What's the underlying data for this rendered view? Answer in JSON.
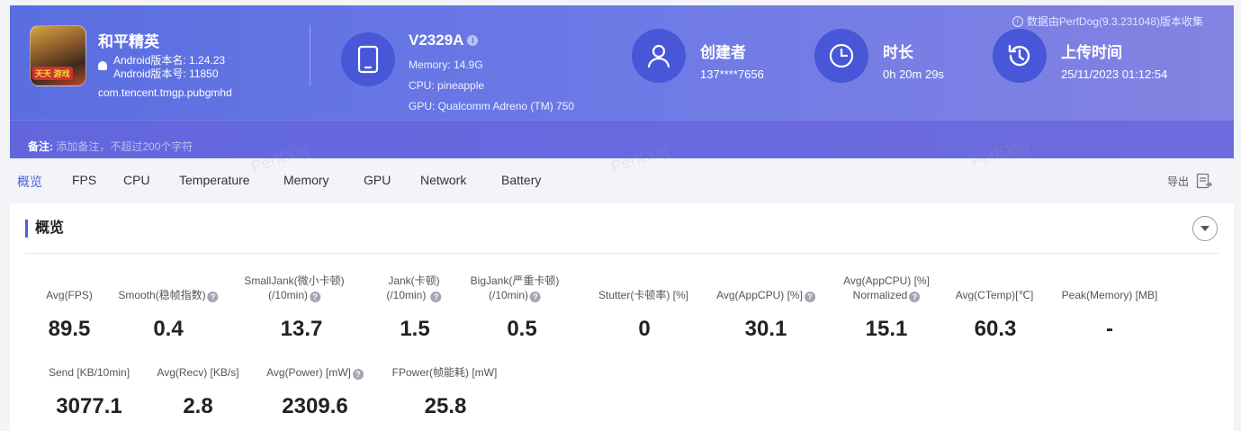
{
  "header": {
    "data_source": "数据由PerfDog(9.3.231048)版本收集",
    "app": {
      "name": "和平精英",
      "version_name": "Android版本名: 1.24.23",
      "version_code": "Android版本号: 11850",
      "package": "com.tencent.tmgp.pubgmhd",
      "icon_badge": "天天 游戏"
    },
    "device": {
      "model": "V2329A",
      "memory": "Memory: 14.9G",
      "cpu": "CPU: pineapple",
      "gpu": "GPU: Qualcomm Adreno (TM) 750"
    },
    "creator": {
      "title": "创建者",
      "value": "137****7656"
    },
    "duration": {
      "title": "时长",
      "value": "0h 20m 29s"
    },
    "upload_time": {
      "title": "上传时间",
      "value": "25/11/2023 01:12:54"
    },
    "note": {
      "label": "备注:",
      "placeholder": "添加备注，不超过200个字符"
    }
  },
  "tabs": [
    "概览",
    "FPS",
    "CPU",
    "Temperature",
    "Memory",
    "GPU",
    "Network",
    "Battery"
  ],
  "active_tab": "概览",
  "export_label": "导出",
  "watermark": "PerfDog",
  "panel": {
    "title": "概览",
    "metrics_row1": [
      {
        "label1": "",
        "label2": "Avg(FPS)",
        "help": false,
        "value": "89.5"
      },
      {
        "label1": "",
        "label2": "Smooth(稳帧指数)",
        "help": true,
        "value": "0.4"
      },
      {
        "label1": "SmallJank(微小卡顿)",
        "label2": "(/10min)",
        "help": true,
        "value": "13.7"
      },
      {
        "label1": "Jank(卡顿)",
        "label2": "(/10min)",
        "help": true,
        "value": "1.5"
      },
      {
        "label1": "BigJank(严重卡顿)",
        "label2": "(/10min)",
        "help": true,
        "value": "0.5"
      },
      {
        "label1": "",
        "label2": "Stutter(卡顿率) [%]",
        "help": false,
        "value": "0"
      },
      {
        "label1": "",
        "label2": "Avg(AppCPU) [%]",
        "help": true,
        "value": "30.1"
      },
      {
        "label1": "Avg(AppCPU) [%]",
        "label2": "Normalized",
        "help": true,
        "value": "15.1"
      },
      {
        "label1": "",
        "label2": "Avg(CTemp)[℃]",
        "help": false,
        "value": "60.3"
      },
      {
        "label1": "",
        "label2": "Peak(Memory) [MB]",
        "help": false,
        "value": "-"
      }
    ],
    "metrics_row2": [
      {
        "label": "Send [KB/10min]",
        "help": false,
        "value": "3077.1"
      },
      {
        "label": "Avg(Recv) [KB/s]",
        "help": false,
        "value": "2.8"
      },
      {
        "label": "Avg(Power) [mW]",
        "help": true,
        "value": "2309.6"
      },
      {
        "label": "FPower(帧能耗) [mW]",
        "help": false,
        "value": "25.8"
      }
    ]
  },
  "colors": {
    "header_start": "#5a6ee0",
    "header_end": "#8383e2",
    "accent": "#4a60e0",
    "icon_circle": "#4856d8"
  }
}
